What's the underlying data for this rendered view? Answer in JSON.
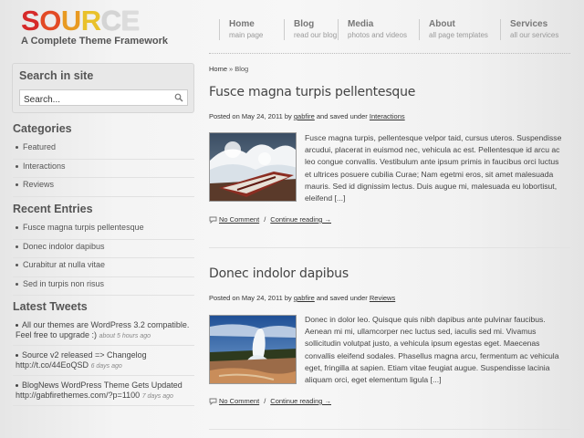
{
  "site": {
    "logo_letters": [
      "S",
      "O",
      "U",
      "R",
      "C",
      "E"
    ],
    "tagline": "A Complete Theme Framework"
  },
  "nav": [
    {
      "title": "Home",
      "sub": "main page"
    },
    {
      "title": "Blog",
      "sub": "read our blog"
    },
    {
      "title": "Media",
      "sub": "photos and videos"
    },
    {
      "title": "About",
      "sub": "all page templates"
    },
    {
      "title": "Services",
      "sub": "all our services"
    }
  ],
  "search": {
    "title": "Search in site",
    "value": "Search...",
    "icon": "magnifier-icon"
  },
  "categories": {
    "title": "Categories",
    "items": [
      "Featured",
      "Interactions",
      "Reviews"
    ]
  },
  "recent": {
    "title": "Recent Entries",
    "items": [
      "Fusce magna turpis pellentesque",
      "Donec indolor dapibus",
      "Curabitur at nulla vitae",
      "Sed in turpis non risus"
    ]
  },
  "tweets": {
    "title": "Latest Tweets",
    "items": [
      {
        "text": "All our themes are WordPress 3.2 compatible. Feel free to upgrade :)",
        "ago": "about 5 hours ago"
      },
      {
        "text": "Source v2 released => Changelog http://t.co/44EoQSD",
        "ago": "6 days ago"
      },
      {
        "text": "BlogNews WordPress Theme Gets Updated http://gabfirethemes.com/?p=1100",
        "ago": "7 days ago"
      }
    ]
  },
  "breadcrumb": {
    "home": "Home",
    "sep": "»",
    "current": "Blog"
  },
  "posts": [
    {
      "title": "Fusce magna turpis pellentesque",
      "meta_prefix": "Posted on May 24, 2011 by",
      "author": "gabfire",
      "meta_mid": "and saved under",
      "category": "Interactions",
      "excerpt": "Fusce magna turpis, pellentesque velpor taid, cursus uteros. Suspendisse arcudui, placerat in euismod nec, vehicula ac est. Pellentesque id arcu ac leo congue convallis. Vestibulum ante ipsum primis in faucibus orci luctus et ultrices posuere cubilia Curae; Nam egetmi eros, sit amet malesuada mauris. Sed id dignissim lectus. Duis augue mi, malesuada eu lobortisut, eleifend [...]",
      "comments": "No Comment",
      "link_sep": "/",
      "more": "Continue reading →",
      "image": "boat-waves-photo"
    },
    {
      "title": "Donec indolor dapibus",
      "meta_prefix": "Posted on May 24, 2011 by",
      "author": "gabfire",
      "meta_mid": "and saved under",
      "category": "Reviews",
      "excerpt": "Donec in dolor leo. Quisque quis nibh dapibus ante pulvinar faucibus. Aenean mi mi, ullamcorper nec luctus sed, iaculis sed mi. Vivamus sollicitudin volutpat justo, a vehicula ipsum egestas eget. Maecenas convallis eleifend sodales. Phasellus magna arcu, fermentum ac vehicula eget, fringilla at sapien. Etiam vitae feugiat augue. Suspendisse lacinia aliquam orci, eget elementum ligula [...]",
      "comments": "No Comment",
      "link_sep": "/",
      "more": "Continue reading →",
      "image": "geyser-photo"
    }
  ],
  "colors": {
    "logo_red": "#d62a2a",
    "logo_orange": "#e89a22",
    "logo_yellow": "#e9c12b",
    "text": "#444444"
  }
}
